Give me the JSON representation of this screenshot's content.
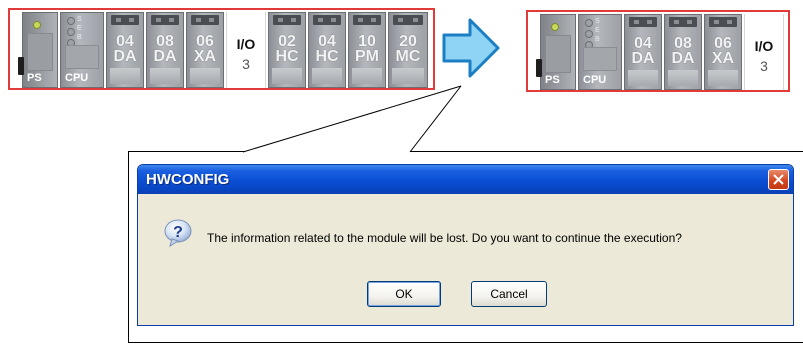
{
  "rack_left": {
    "ps_label": "PS",
    "cpu_label": "CPU",
    "cpu_leds": [
      "S",
      "E",
      "B"
    ],
    "modules_a": [
      {
        "top": "04",
        "bottom": "DA"
      },
      {
        "top": "08",
        "bottom": "DA"
      },
      {
        "top": "06",
        "bottom": "XA"
      }
    ],
    "io_label": "I/O",
    "io_number": "3",
    "modules_b": [
      {
        "top": "02",
        "bottom": "HC"
      },
      {
        "top": "04",
        "bottom": "HC"
      },
      {
        "top": "10",
        "bottom": "PM"
      },
      {
        "top": "20",
        "bottom": "MC"
      }
    ]
  },
  "rack_right": {
    "ps_label": "PS",
    "cpu_label": "CPU",
    "cpu_leds": [
      "S",
      "E",
      "B"
    ],
    "modules_a": [
      {
        "top": "04",
        "bottom": "DA"
      },
      {
        "top": "08",
        "bottom": "DA"
      },
      {
        "top": "06",
        "bottom": "XA"
      }
    ],
    "io_label": "I/O",
    "io_number": "3"
  },
  "dialog": {
    "title": "HWCONFIG",
    "message": "The information related to the module will be lost. Do you want to continue the execution?",
    "ok_label": "OK",
    "cancel_label": "Cancel"
  },
  "colors": {
    "rack_border": "#e03a3a",
    "arrow_fill": "#8fd3f5",
    "arrow_stroke": "#1a7fc4",
    "title_bar": "#0a4ed4",
    "dialog_face": "#ece9d8"
  },
  "icons": {
    "arrow": "right-arrow-icon",
    "question": "question-icon",
    "close": "close-icon"
  }
}
